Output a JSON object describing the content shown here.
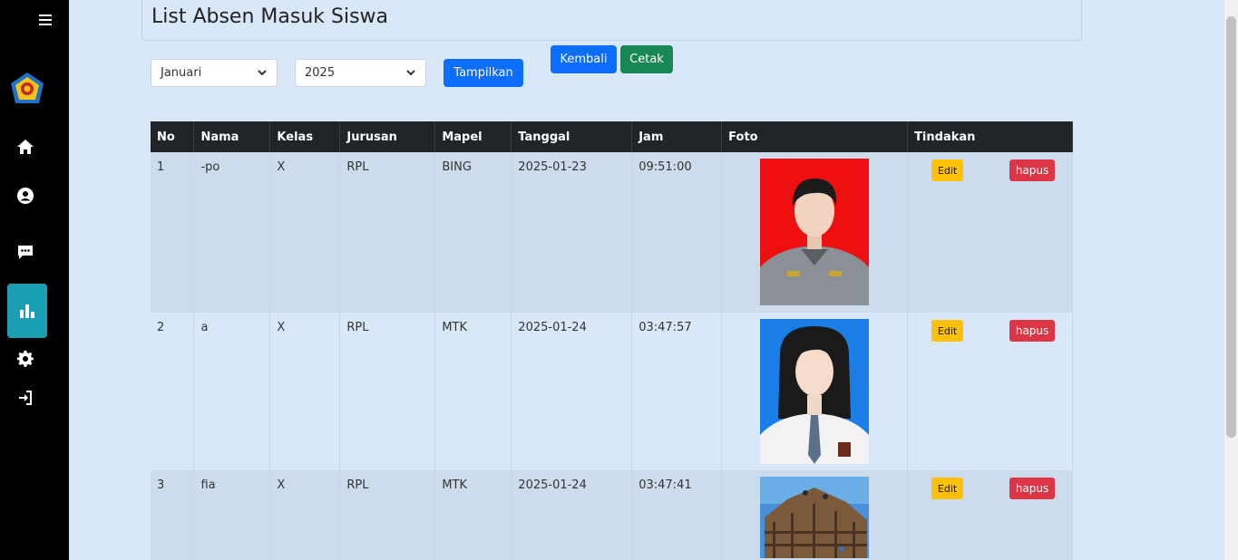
{
  "page": {
    "title": "List Absen Masuk Siswa"
  },
  "sidebar": {
    "items": [
      {
        "name": "menu-toggle",
        "icon": "hamburger-icon"
      },
      {
        "name": "home",
        "icon": "home-icon"
      },
      {
        "name": "profile",
        "icon": "user-circle-icon"
      },
      {
        "name": "messages",
        "icon": "message-icon"
      },
      {
        "name": "reports",
        "icon": "bar-chart-icon",
        "active": true
      },
      {
        "name": "settings",
        "icon": "gear-icon"
      },
      {
        "name": "logout",
        "icon": "sign-in-icon"
      }
    ],
    "accent": "#1a9fb2"
  },
  "filters": {
    "month": "Januari",
    "year": "2025",
    "show_label": "Tampilkan"
  },
  "actions": {
    "back_label": "Kembali",
    "print_label": "Cetak"
  },
  "table": {
    "headers": [
      "No",
      "Nama",
      "Kelas",
      "Jurusan",
      "Mapel",
      "Tanggal",
      "Jam",
      "Foto",
      "Tindakan"
    ],
    "edit_label": "Edit",
    "delete_label": "hapus",
    "rows": [
      {
        "no": "1",
        "nama": "-po",
        "kelas": "X",
        "jurusan": "RPL",
        "mapel": "BING",
        "tanggal": "2025-01-23",
        "jam": "09:51:00"
      },
      {
        "no": "2",
        "nama": "a",
        "kelas": "X",
        "jurusan": "RPL",
        "mapel": "MTK",
        "tanggal": "2025-01-24",
        "jam": "03:47:57"
      },
      {
        "no": "3",
        "nama": "fia",
        "kelas": "X",
        "jurusan": "RPL",
        "mapel": "MTK",
        "tanggal": "2025-01-24",
        "jam": "03:47:41"
      }
    ]
  },
  "colors": {
    "primary": "#0d6efd",
    "success": "#198754",
    "warning": "#ffc107",
    "danger": "#dc3545",
    "table_header": "#212529"
  }
}
